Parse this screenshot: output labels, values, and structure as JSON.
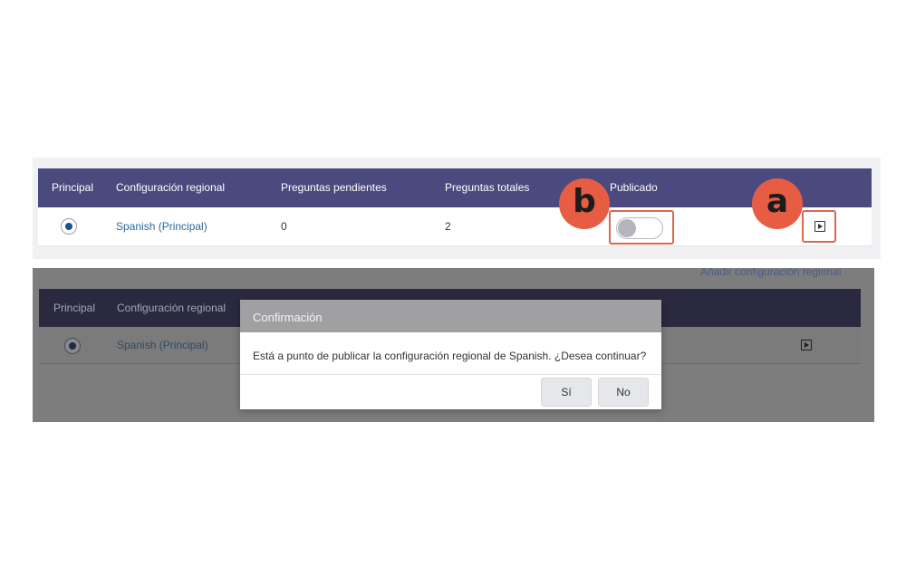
{
  "top_table": {
    "headers": [
      "Principal",
      "Configuración regional",
      "Preguntas pendientes",
      "Preguntas totales",
      "Publicado"
    ],
    "row": {
      "principal_selected": true,
      "locale": "Spanish (Principal)",
      "pending_questions": "0",
      "total_questions": "2",
      "published": false
    }
  },
  "annotations": {
    "b": "b",
    "a": "a",
    "highlight_color": "#d9694d",
    "badge_color": "#e65d44"
  },
  "bottom_view": {
    "add_locale_link": "Añadir configuración regional",
    "headers": [
      "Principal",
      "Configuración regional"
    ],
    "row": {
      "locale": "Spanish (Principal)"
    }
  },
  "dialog": {
    "title": "Confirmación",
    "message": "Está a punto de publicar la configuración regional de Spanish. ¿Desea continuar?",
    "yes_label": "Sí",
    "no_label": "No"
  },
  "colors": {
    "header_bg": "#4b4a7e",
    "link": "#2a6a9c",
    "radio_dot": "#1d4f91"
  },
  "icons": [
    "radio-selected-icon",
    "play-icon"
  ]
}
